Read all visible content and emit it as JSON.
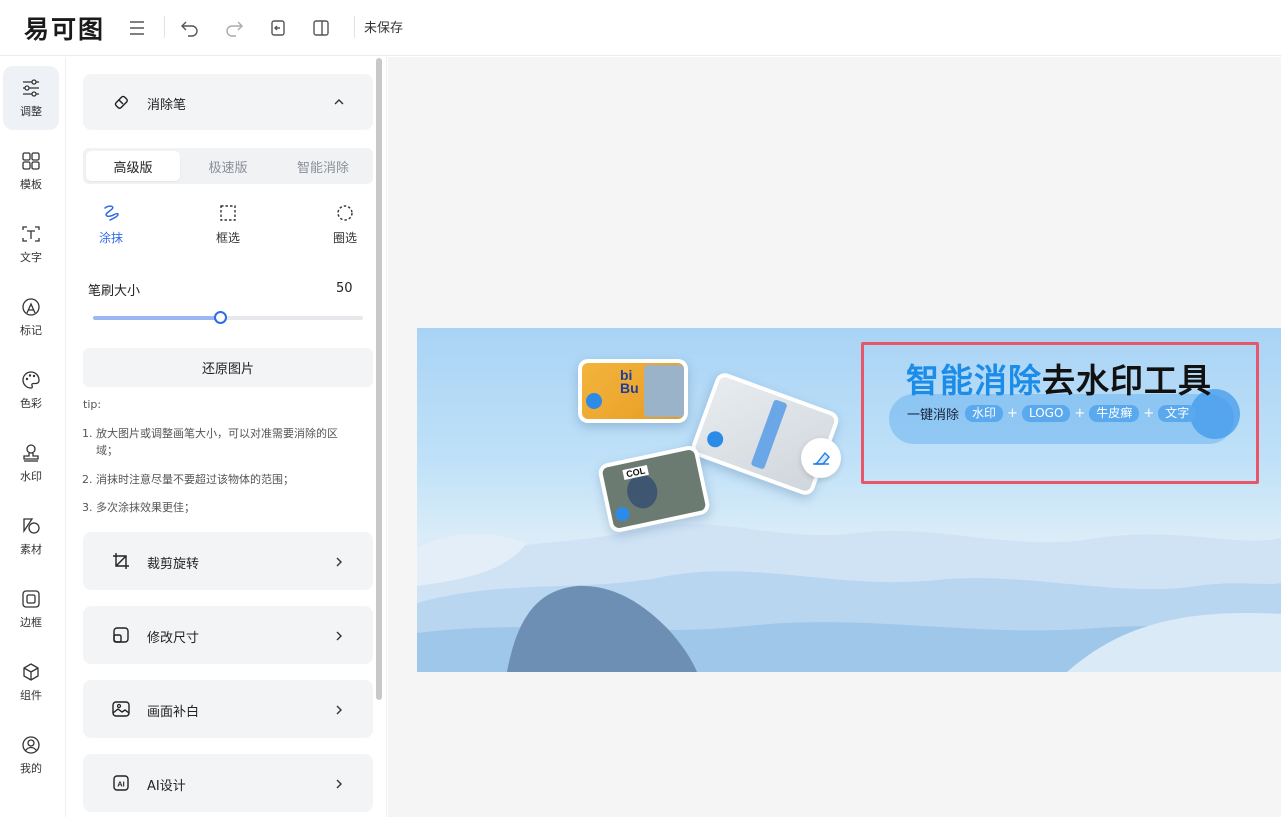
{
  "topbar": {
    "logo": "易可图",
    "status": "未保存",
    "icons": [
      "menu-icon",
      "undo-icon",
      "redo-icon",
      "import-icon",
      "compare-icon"
    ]
  },
  "rail": {
    "items": [
      {
        "label": "调整",
        "icon": "adjust-sliders-icon",
        "active": true
      },
      {
        "label": "模板",
        "icon": "template-grid-icon"
      },
      {
        "label": "文字",
        "icon": "text-icon"
      },
      {
        "label": "标记",
        "icon": "marker-icon"
      },
      {
        "label": "色彩",
        "icon": "palette-icon"
      },
      {
        "label": "水印",
        "icon": "watermark-stamp-icon"
      },
      {
        "label": "素材",
        "icon": "material-shapes-icon"
      },
      {
        "label": "边框",
        "icon": "border-frame-icon"
      },
      {
        "label": "组件",
        "icon": "component-cube-icon"
      },
      {
        "label": "我的",
        "icon": "user-icon"
      }
    ]
  },
  "panel": {
    "eraser": {
      "title": "消除笔",
      "tabs": [
        "高级版",
        "极速版",
        "智能消除"
      ],
      "active_tab": "高级版",
      "modes": [
        "涂抹",
        "框选",
        "圈选"
      ],
      "active_mode": "涂抹",
      "brush_label": "笔刷大小",
      "brush_value": "50",
      "brush_fraction": 0.47,
      "restore_label": "还原图片",
      "tip_title": "tip:",
      "tips": [
        {
          "first": "1. 放大图片或调整画笔大小，可以对准需要消除的区",
          "rest": "域；"
        },
        {
          "first": "2. 消抹时注意尽量不要超过该物体的范围；",
          "rest": ""
        },
        {
          "first": "3. 多次涂抹效果更佳；",
          "rest": ""
        }
      ]
    },
    "sections": [
      {
        "label": "裁剪旋转",
        "icon": "crop-rotate-icon"
      },
      {
        "label": "修改尺寸",
        "icon": "resize-icon"
      },
      {
        "label": "画面补白",
        "icon": "image-fill-icon"
      },
      {
        "label": "AI设计",
        "icon": "ai-design-icon"
      }
    ]
  },
  "canvas": {
    "headline_a": "智能消除",
    "headline_b": "去水印工具",
    "subline": "一键消除",
    "tags": [
      "水印",
      "LOGO",
      "牛皮癣",
      "文字"
    ],
    "plus": "+",
    "card_label_bub": "bi Bu",
    "card_label_col": "COL"
  },
  "colors": {
    "accent": "#2f6ce5",
    "selection_border": "#e8566a",
    "headline_blue": "#1b8de8"
  }
}
